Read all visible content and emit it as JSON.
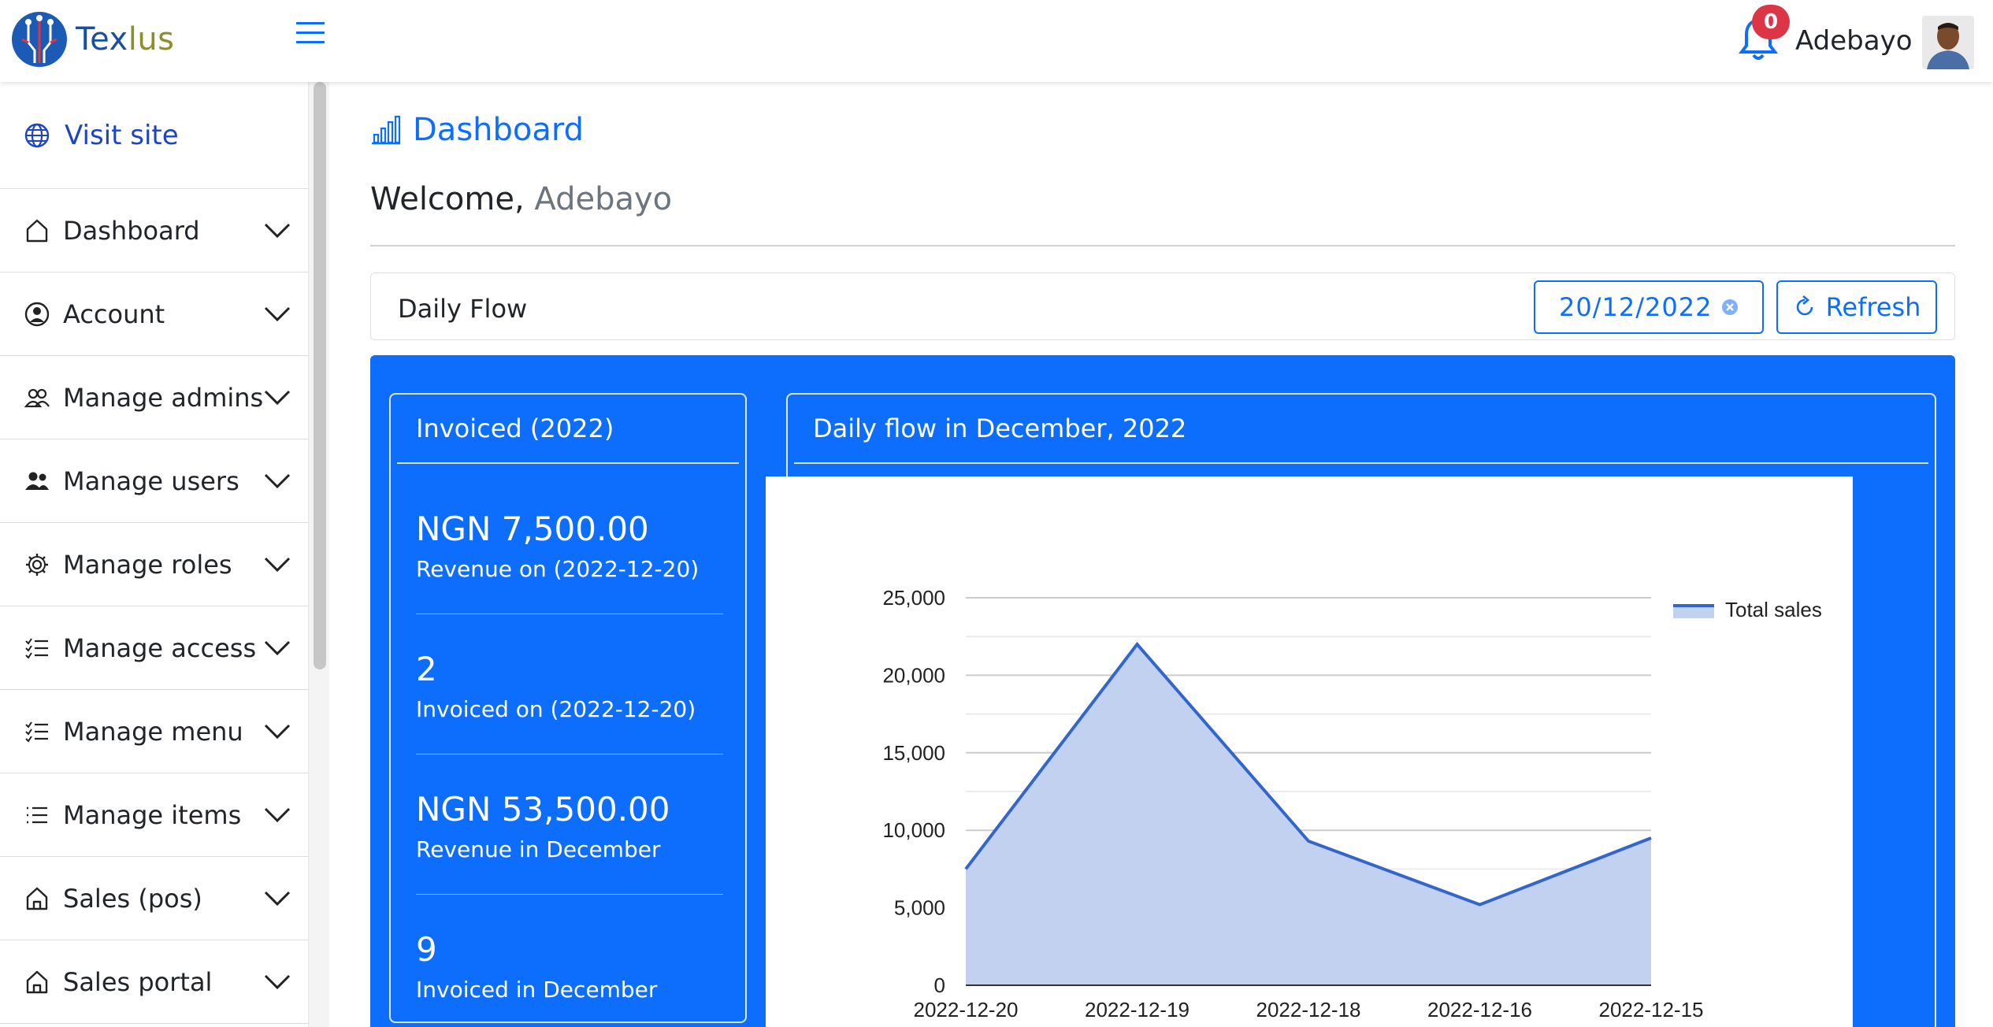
{
  "brand": {
    "name_part1": "Tex",
    "name_part2": "lus"
  },
  "header": {
    "notification_count": "0",
    "user_name": "Adebayo"
  },
  "sidebar": {
    "visit_site": "Visit site",
    "items": [
      {
        "label": "Dashboard",
        "icon": "home-icon"
      },
      {
        "label": "Account",
        "icon": "user-circle-icon"
      },
      {
        "label": "Manage admins",
        "icon": "people-icon"
      },
      {
        "label": "Manage users",
        "icon": "people-fill-icon"
      },
      {
        "label": "Manage roles",
        "icon": "gear-icon"
      },
      {
        "label": "Manage access",
        "icon": "list-check-icon"
      },
      {
        "label": "Manage menu",
        "icon": "list-check-icon"
      },
      {
        "label": "Manage items",
        "icon": "list-icon"
      },
      {
        "label": "Sales (pos)",
        "icon": "home-icon"
      },
      {
        "label": "Sales portal",
        "icon": "home-icon"
      }
    ]
  },
  "main": {
    "page_title": "Dashboard",
    "welcome_prefix": "Welcome,",
    "welcome_name": "Adebayo",
    "daily_flow_title": "Daily Flow",
    "date_value": "20/12/2022",
    "refresh_label": "Refresh"
  },
  "invoiced": {
    "title": "Invoiced (2022)",
    "stats": [
      {
        "value": "NGN 7,500.00",
        "label": "Revenue on (2022-12-20)"
      },
      {
        "value": "2",
        "label": "Invoiced on (2022-12-20)"
      },
      {
        "value": "NGN 53,500.00",
        "label": "Revenue in December"
      },
      {
        "value": "9",
        "label": "Invoiced in December"
      }
    ]
  },
  "chart_card": {
    "title": "Daily flow in December, 2022"
  },
  "chart_data": {
    "type": "area",
    "categories": [
      "2022-12-20",
      "2022-12-19",
      "2022-12-18",
      "2022-12-16",
      "2022-12-15"
    ],
    "series": [
      {
        "name": "Total sales",
        "values": [
          7500,
          22000,
          9300,
          5200,
          9500
        ]
      }
    ],
    "ylim": [
      0,
      25000
    ],
    "yticks": [
      0,
      5000,
      10000,
      15000,
      20000,
      25000
    ],
    "ytick_labels": [
      "0",
      "5,000",
      "10,000",
      "15,000",
      "20,000",
      "25,000"
    ],
    "grid": true,
    "legend": "right",
    "colors": {
      "line": "#3366cc",
      "fill": "#c2d1ef",
      "grid": "#cccccc"
    }
  }
}
